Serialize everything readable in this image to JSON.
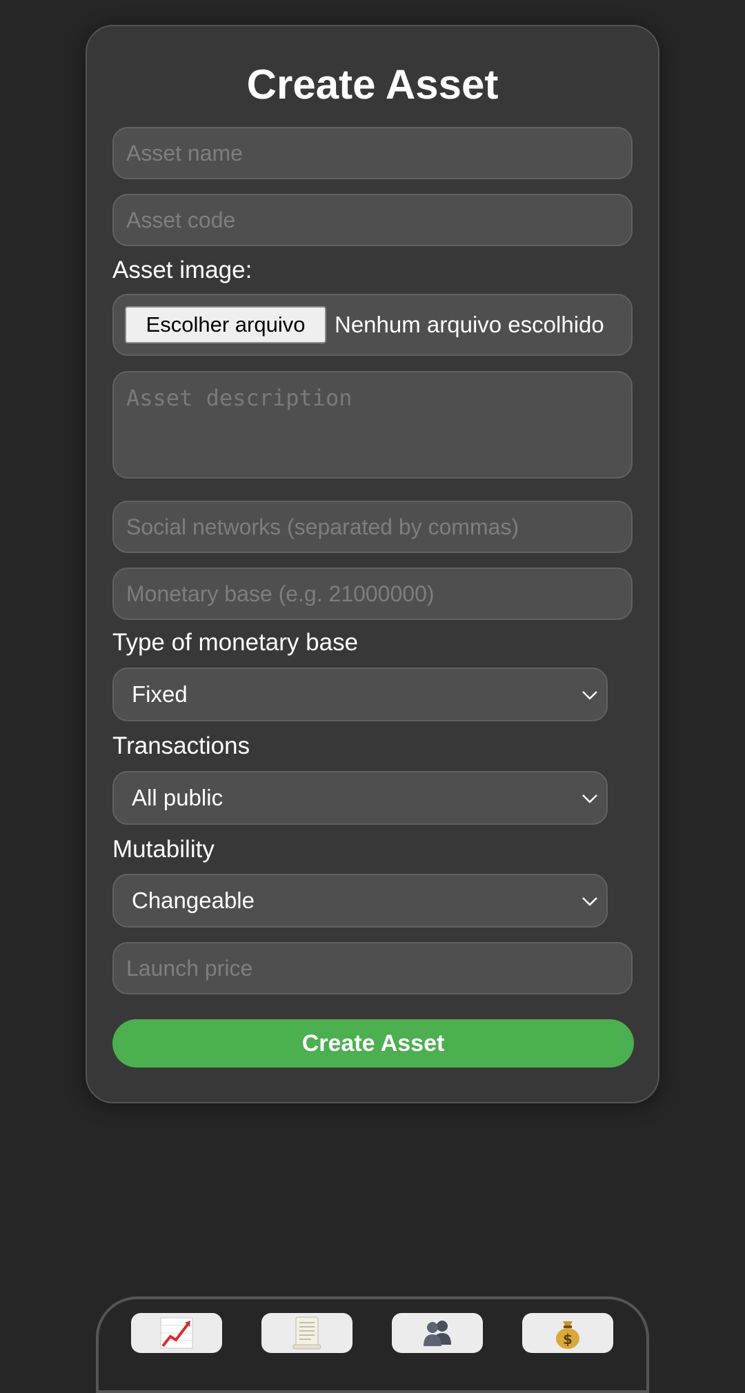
{
  "form": {
    "title": "Create Asset",
    "asset_name_placeholder": "Asset name",
    "asset_code_placeholder": "Asset code",
    "asset_image_label": "Asset image:",
    "file_button_label": "Escolher arquivo",
    "file_status": "Nenhum arquivo escolhido",
    "description_placeholder": "Asset description",
    "social_placeholder": "Social networks (separated by commas)",
    "monetary_base_placeholder": "Monetary base (e.g. 21000000)",
    "monetary_type_label": "Type of monetary base",
    "monetary_type_value": "Fixed",
    "transactions_label": "Transactions",
    "transactions_value": "All public",
    "mutability_label": "Mutability",
    "mutability_value": "Changeable",
    "launch_price_placeholder": "Launch price",
    "submit_label": "Create Asset"
  },
  "nav": {
    "items": [
      {
        "icon": "chart-increasing-icon"
      },
      {
        "icon": "scroll-icon"
      },
      {
        "icon": "people-icon"
      },
      {
        "icon": "money-bag-icon"
      }
    ]
  },
  "colors": {
    "background": "#262626",
    "card": "#383838",
    "field": "#4f4f4f",
    "accent_green": "#4caf50"
  }
}
